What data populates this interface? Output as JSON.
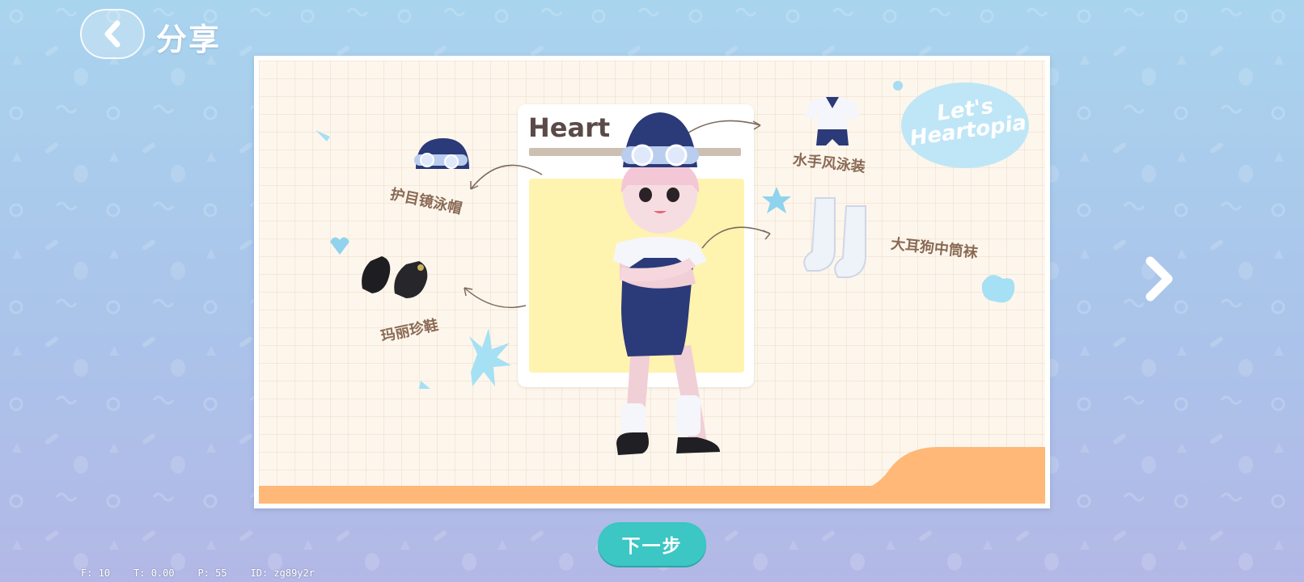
{
  "header": {
    "title": "分享",
    "back_icon": "chevron-left-icon"
  },
  "card": {
    "poster_title": "Heart",
    "badge_line1": "Let's",
    "badge_line2": "Heartopia",
    "items": [
      {
        "label": "护目镜泳帽",
        "icon": "swim-cap-goggles-icon"
      },
      {
        "label": "水手风泳装",
        "icon": "sailor-swimsuit-icon"
      },
      {
        "label": "大耳狗中筒袜",
        "icon": "mid-calf-socks-icon"
      },
      {
        "label": "玛丽珍鞋",
        "icon": "mary-jane-shoes-icon"
      }
    ]
  },
  "navigation": {
    "next_arrow_icon": "chevron-right-icon",
    "next_step_label": "下一步"
  },
  "debug": {
    "text": "F: 10    T: 0.00    P: 55    ID: zg89y2r"
  },
  "colors": {
    "accent_teal": "#3cc6c4",
    "card_bg": "#fdf6ec",
    "orange_band": "#ffb877",
    "badge_blue": "#bfe6f7"
  }
}
